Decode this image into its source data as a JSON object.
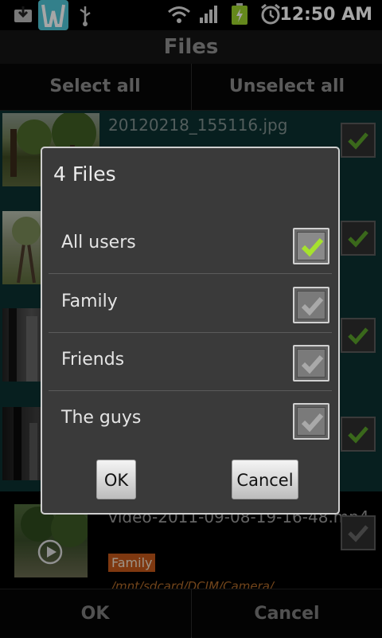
{
  "statusbar": {
    "time": "12:50 AM",
    "icons": [
      "download-notification-icon",
      "app-w-icon",
      "usb-icon",
      "wifi-icon",
      "signal-icon",
      "battery-charging-icon",
      "alarm-icon"
    ]
  },
  "header": {
    "title": "Files"
  },
  "selectbar": {
    "select_all": "Select all",
    "unselect_all": "Unselect all"
  },
  "filelist": {
    "items": [
      {
        "name": "20120218_155116.jpg",
        "selected": true,
        "checked": true
      },
      {
        "name": "",
        "selected": true,
        "checked": true
      },
      {
        "name": "",
        "selected": true,
        "checked": true
      },
      {
        "name": "",
        "selected": true,
        "checked": true
      },
      {
        "name": "video-2011-09-08-19-16-48.mp4",
        "selected": false,
        "checked": true,
        "tag": "Family",
        "path": "/mnt/sdcard/DCIM/Camera/"
      }
    ]
  },
  "bottombar": {
    "ok": "OK",
    "cancel": "Cancel"
  },
  "dialog": {
    "title": "4 Files",
    "options": [
      {
        "label": "All users",
        "checked": true,
        "state": "active"
      },
      {
        "label": "Family",
        "checked": true,
        "state": "disabled"
      },
      {
        "label": "Friends",
        "checked": true,
        "state": "disabled"
      },
      {
        "label": "The guys",
        "checked": true,
        "state": "disabled"
      }
    ],
    "ok": "OK",
    "cancel": "Cancel"
  },
  "colors": {
    "accent_check": "#a6e22e",
    "selected_row": "#0c3130",
    "tag_bg": "#c2561a"
  }
}
